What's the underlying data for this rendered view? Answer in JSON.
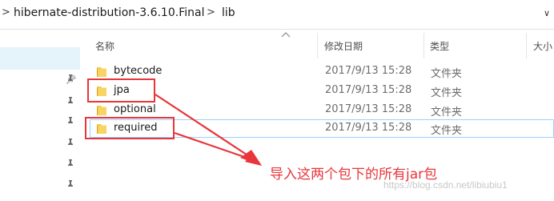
{
  "address_bar": {
    "crumbs": [
      "hibernate-distribution-3.6.10.Final",
      "lib"
    ],
    "separator": ">",
    "dropdown_glyph": "∨"
  },
  "columns": {
    "name": "名称",
    "modified": "修改日期",
    "type": "类型",
    "size": "大小"
  },
  "files": [
    {
      "name": "bytecode",
      "modified": "2017/9/13 15:28",
      "type": "文件夹",
      "icon": "folder-icon",
      "highlighted": false,
      "focused": false
    },
    {
      "name": "jpa",
      "modified": "2017/9/13 15:28",
      "type": "文件夹",
      "icon": "folder-icon",
      "highlighted": true,
      "focused": false
    },
    {
      "name": "optional",
      "modified": "2017/9/13 15:28",
      "type": "文件夹",
      "icon": "folder-icon",
      "highlighted": false,
      "focused": false
    },
    {
      "name": "required",
      "modified": "2017/9/13 15:28",
      "type": "文件夹",
      "icon": "folder-icon",
      "highlighted": true,
      "focused": true
    }
  ],
  "annotation": {
    "text": "导入这两个包下的所有jar包",
    "color": "#e8363b"
  },
  "watermark": "https://blog.csdn.net/libiubiu1",
  "colors": {
    "selection_bg": "#e5f3fb",
    "focus_border": "#99d1ff",
    "folder_yellow": "#f4c743",
    "folder_dark": "#d9a520"
  },
  "nav_icons": [
    "pin-icon",
    "pin-icon",
    "pin-icon",
    "pin-icon",
    "pin-icon",
    "pin-icon"
  ]
}
